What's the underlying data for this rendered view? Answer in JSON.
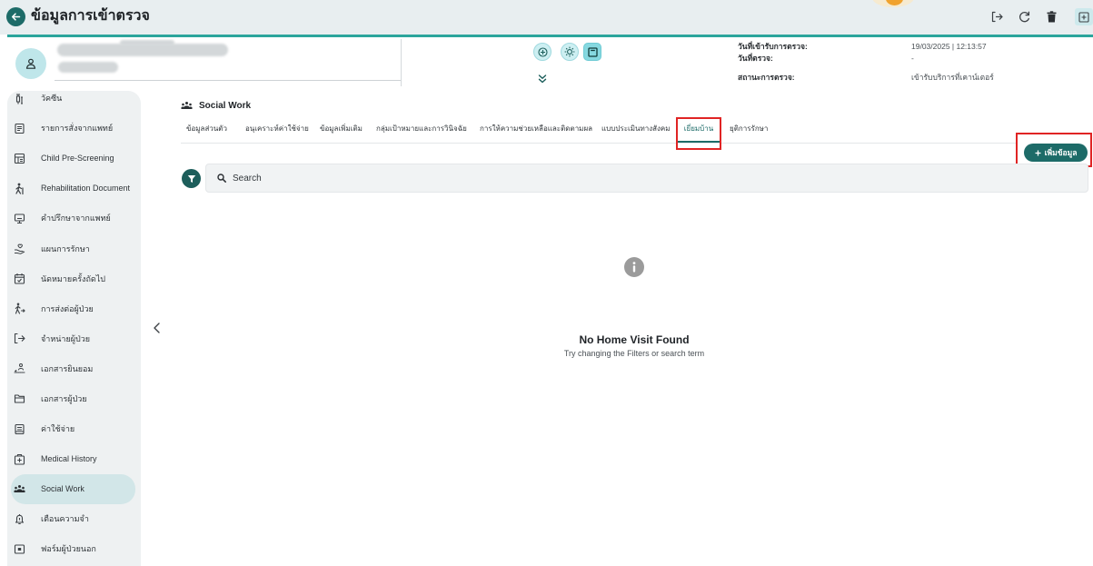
{
  "app": {
    "title": "ข้อมูลการเข้าตรวจ",
    "back_icon": "back-arrow-icon"
  },
  "topbar": {
    "actions": [
      {
        "icon": "logout-icon"
      },
      {
        "icon": "refresh-icon"
      },
      {
        "icon": "trash-icon"
      },
      {
        "icon": "add-box-icon"
      }
    ]
  },
  "patient": {
    "avatar_icon": "person-icon",
    "action_icons": [
      "health-status-icon",
      "sun-icon",
      "note-icon"
    ],
    "expand_icon": "double-chevron-down-icon",
    "visit_info": [
      {
        "label": "วันที่เข้ารับการตรวจ:",
        "value": "19/03/2025 | 12:13:57"
      },
      {
        "label": "วันที่ตรวจ:",
        "value": "-"
      },
      {
        "label": "สถานะการตรวจ:",
        "value": "เข้ารับบริการที่เคาน์เตอร์"
      }
    ]
  },
  "sidebar": {
    "active_index": 13,
    "collapse_icon": "chevron-left-icon",
    "items": [
      {
        "label": "วัคซีน",
        "icon": "vaccine-icon"
      },
      {
        "label": "รายการสั่งจากแพทย์",
        "icon": "list-document-icon"
      },
      {
        "label": "Child Pre-Screening",
        "icon": "screening-form-icon"
      },
      {
        "label": "Rehabilitation Document",
        "icon": "rehabilitation-icon"
      },
      {
        "label": "คำปรึกษาจากแพทย์",
        "icon": "consultation-icon"
      },
      {
        "label": "แผนการรักษา",
        "icon": "treatment-plan-icon"
      },
      {
        "label": "นัดหมายครั้งถัดไป",
        "icon": "calendar-icon"
      },
      {
        "label": "การส่งต่อผู้ป่วย",
        "icon": "patient-transfer-icon"
      },
      {
        "label": "จำหน่ายผู้ป่วย",
        "icon": "discharge-icon"
      },
      {
        "label": "เอกสารยินยอม",
        "icon": "consent-signature-icon"
      },
      {
        "label": "เอกสารผู้ป่วย",
        "icon": "folder-icon"
      },
      {
        "label": "ค่าใช้จ่าย",
        "icon": "receipt-icon"
      },
      {
        "label": "Medical History",
        "icon": "medical-history-icon"
      },
      {
        "label": "Social Work",
        "icon": "people-group-icon"
      },
      {
        "label": "เตือนความจำ",
        "icon": "reminder-icon"
      },
      {
        "label": "ฟอร์มผู้ป่วยนอก",
        "icon": "outpatient-form-icon"
      }
    ]
  },
  "main": {
    "section_title": "Social Work",
    "section_icon": "people-group-icon",
    "active_tab": 6,
    "tabs": [
      {
        "label": "ข้อมูลส่วนตัว"
      },
      {
        "label": "อนุเคราะห์ค่าใช้จ่าย"
      },
      {
        "label": "ข้อมูลเพิ่มเติม"
      },
      {
        "label": "กลุ่มเป้าหมายและการวินิจฉัย"
      },
      {
        "label": "การให้ความช่วยเหลือและติดตามผล"
      },
      {
        "label": "แบบประเมินทางสังคม"
      },
      {
        "label": "เยี่ยมบ้าน"
      },
      {
        "label": "ยุติการรักษา"
      }
    ],
    "add_button": {
      "icon": "plus-icon",
      "label": "เพิ่มข้อมูล"
    },
    "filter_icon": "filter-icon",
    "search": {
      "icon": "search-icon",
      "placeholder": "Search",
      "value": ""
    },
    "empty_state": {
      "icon": "info-icon",
      "title": "No Home Visit Found",
      "subtitle": "Try changing the Filters or search term"
    }
  },
  "colors": {
    "accent": "#1d6b68",
    "accent_line": "#2ba59c",
    "active_item_bg": "#d2e6e8",
    "sidebar_bg": "#eef1f2",
    "annotation": "#e02424"
  }
}
